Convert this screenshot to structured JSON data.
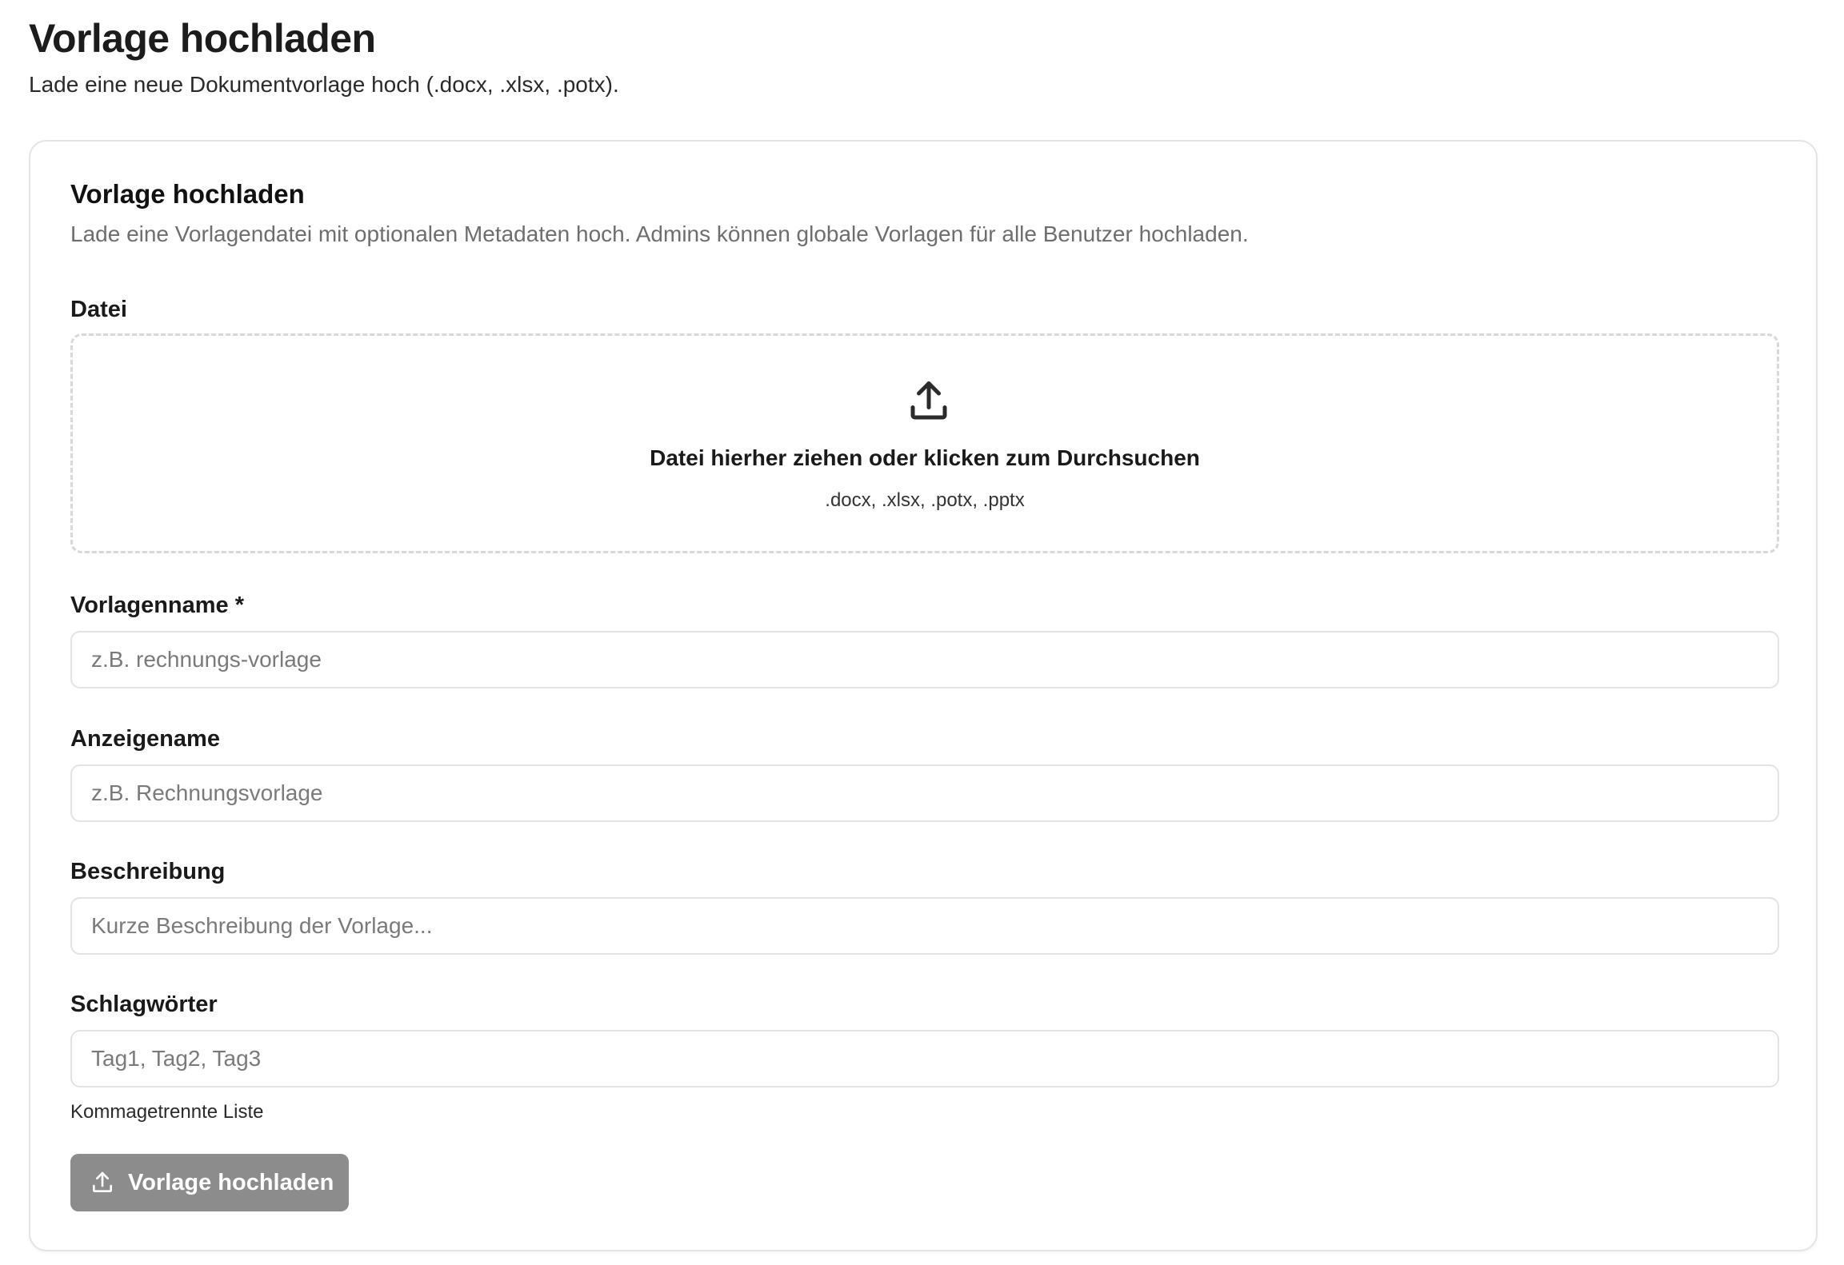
{
  "page": {
    "title": "Vorlage hochladen",
    "subtitle": "Lade eine neue Dokumentvorlage hoch (.docx, .xlsx, .potx)."
  },
  "card": {
    "title": "Vorlage hochladen",
    "description": "Lade eine Vorlagendatei mit optionalen Metadaten hoch. Admins können globale Vorlagen für alle Benutzer hochladen."
  },
  "file": {
    "label": "Datei",
    "dropzone_title": "Datei hierher ziehen oder klicken zum Durchsuchen",
    "dropzone_hint": ".docx, .xlsx, .potx, .pptx",
    "icon": "upload-icon"
  },
  "fields": {
    "template_name": {
      "label": "Vorlagenname *",
      "placeholder": "z.B. rechnungs-vorlage",
      "value": ""
    },
    "display_name": {
      "label": "Anzeigename",
      "placeholder": "z.B. Rechnungsvorlage",
      "value": ""
    },
    "description": {
      "label": "Beschreibung",
      "placeholder": "Kurze Beschreibung der Vorlage...",
      "value": ""
    },
    "tags": {
      "label": "Schlagwörter",
      "placeholder": "Tag1, Tag2, Tag3",
      "value": "",
      "helper": "Kommagetrennte Liste"
    }
  },
  "submit": {
    "label": "Vorlage hochladen",
    "icon": "upload-icon",
    "state": "disabled"
  },
  "colors": {
    "button_disabled": "#8c8c8c",
    "border": "#e3e3e3",
    "muted_text": "#6e6e6e"
  }
}
